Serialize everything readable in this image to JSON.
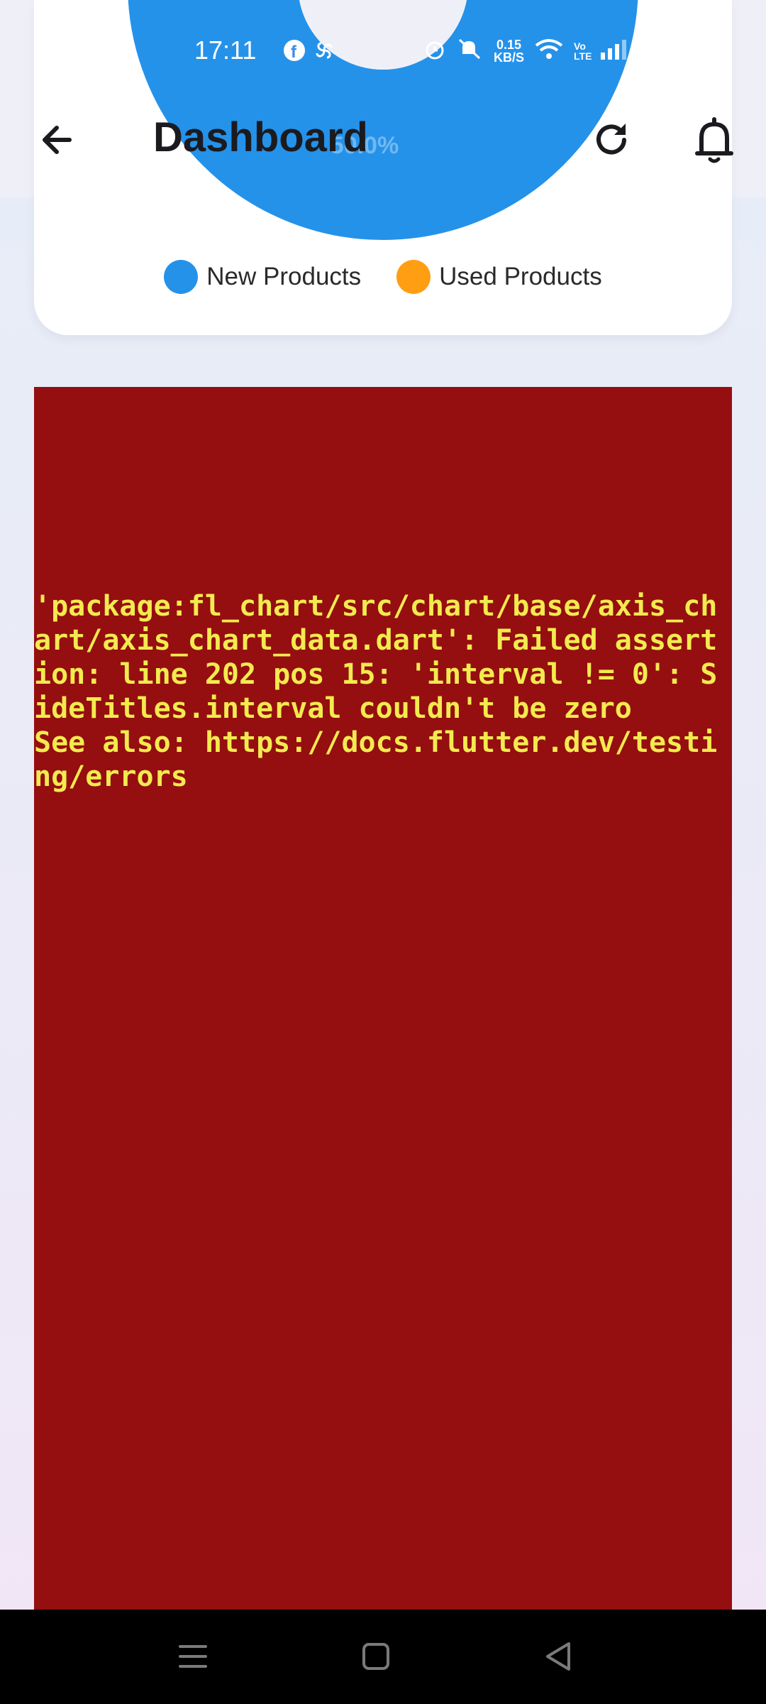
{
  "status_bar": {
    "time": "17:11",
    "net_speed_value": "0.15",
    "net_speed_unit": "KB/S",
    "volte": "Vo LTE"
  },
  "app_bar": {
    "title": "Dashboard"
  },
  "chart": {
    "center_label": "50.0%",
    "legend": [
      {
        "label": "New Products",
        "color": "#2592ea"
      },
      {
        "label": "Used Products",
        "color": "#ff9e12"
      }
    ]
  },
  "chart_data": {
    "type": "pie",
    "categories": [
      "New Products",
      "Used Products"
    ],
    "series": [
      {
        "values": [
          50.0,
          50.0
        ]
      }
    ],
    "title": ""
  },
  "error": {
    "message": "'package:fl_chart/src/chart/base/axis_chart/axis_chart_data.dart': Failed assertion: line 202 pos 15: 'interval != 0': SideTitles.interval couldn't be zero\nSee also: https://docs.flutter.dev/testing/errors"
  },
  "icons": {
    "back": "arrow-back-icon",
    "refresh": "refresh-icon",
    "notifications": "bell-icon",
    "nav_recent": "menu-icon",
    "nav_home": "square-icon",
    "nav_back": "triangle-back-icon"
  }
}
